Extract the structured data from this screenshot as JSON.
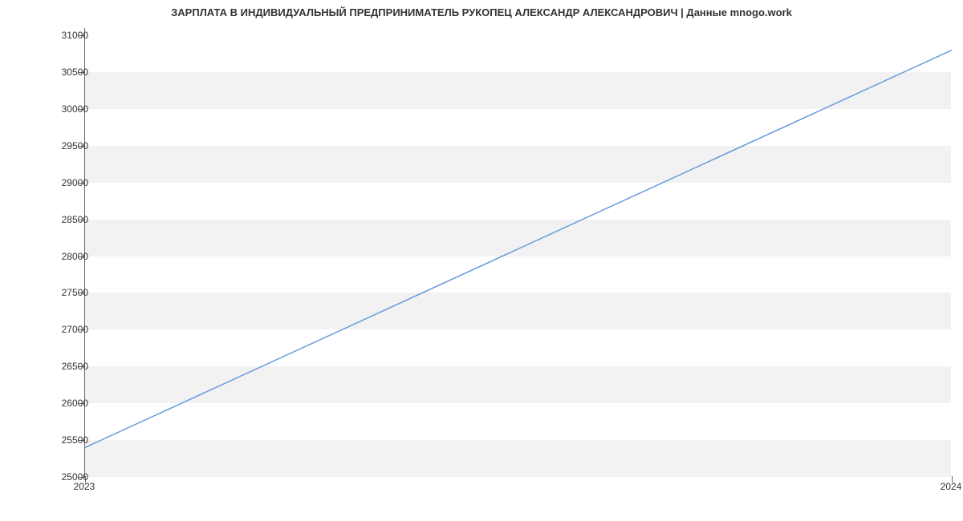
{
  "chart_data": {
    "type": "line",
    "title": "ЗАРПЛАТА В ИНДИВИДУАЛЬНЫЙ ПРЕДПРИНИМАТЕЛЬ РУКОПЕЦ АЛЕКСАНДР АЛЕКСАНДРОВИЧ | Данные mnogo.work",
    "x": [
      "2023",
      "2024"
    ],
    "values": [
      25400,
      30800
    ],
    "x_ticks": [
      "2023",
      "2024"
    ],
    "y_ticks": [
      25000,
      25500,
      26000,
      26500,
      27000,
      27500,
      28000,
      28500,
      29000,
      29500,
      30000,
      30500,
      31000
    ],
    "ylim": [
      25000,
      31100
    ],
    "xlabel": "",
    "ylabel": "",
    "line_color": "#6a9ae0",
    "band_color": "#f2f2f2"
  }
}
